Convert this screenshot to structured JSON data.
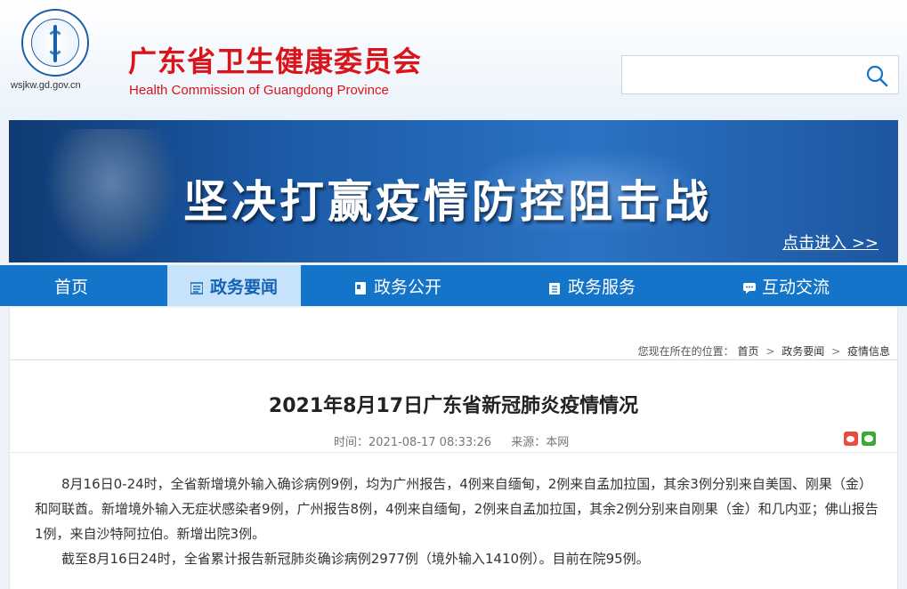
{
  "header": {
    "domain": "wsjkw.gd.gov.cn",
    "org_name_cn": "广东省卫生健康委员会",
    "org_name_en": "Health Commission of Guangdong Province",
    "search": {
      "value": "",
      "placeholder": ""
    }
  },
  "banner": {
    "slogan": "坚决打赢疫情防控阻击战",
    "enter_label": "点击进入 >>"
  },
  "nav": {
    "items": [
      {
        "label": "首页",
        "icon": "none"
      },
      {
        "label": "政务要闻",
        "icon": "list-icon",
        "active": true
      },
      {
        "label": "政务公开",
        "icon": "document-icon"
      },
      {
        "label": "政务服务",
        "icon": "clipboard-icon"
      },
      {
        "label": "互动交流",
        "icon": "chat-icon"
      }
    ]
  },
  "breadcrumb": {
    "prefix": "您现在所在的位置：",
    "items": [
      "首页",
      "政务要闻",
      "疫情信息"
    ],
    "sep": ">"
  },
  "article": {
    "title": "2021年8月17日广东省新冠肺炎疫情情况",
    "time": "时间：2021-08-17 08:33:26",
    "source": "来源：本网",
    "paragraphs": [
      "8月16日0-24时，全省新增境外输入确诊病例9例，均为广州报告，4例来自缅甸，2例来自孟加拉国，其余3例分别来自美国、刚果（金）和阿联酋。新增境外输入无症状感染者9例，广州报告8例，4例来自缅甸，2例来自孟加拉国，其余2例分别来自刚果（金）和几内亚；佛山报告1例，来自沙特阿拉伯。新增出院3例。",
      "截至8月16日24时，全省累计报告新冠肺炎确诊病例2977例（境外输入1410例）。目前在院95例。"
    ]
  },
  "colors": {
    "brand_red": "#d9151b",
    "nav_blue": "#1474c9",
    "nav_active_bg": "#c7e3fb"
  }
}
